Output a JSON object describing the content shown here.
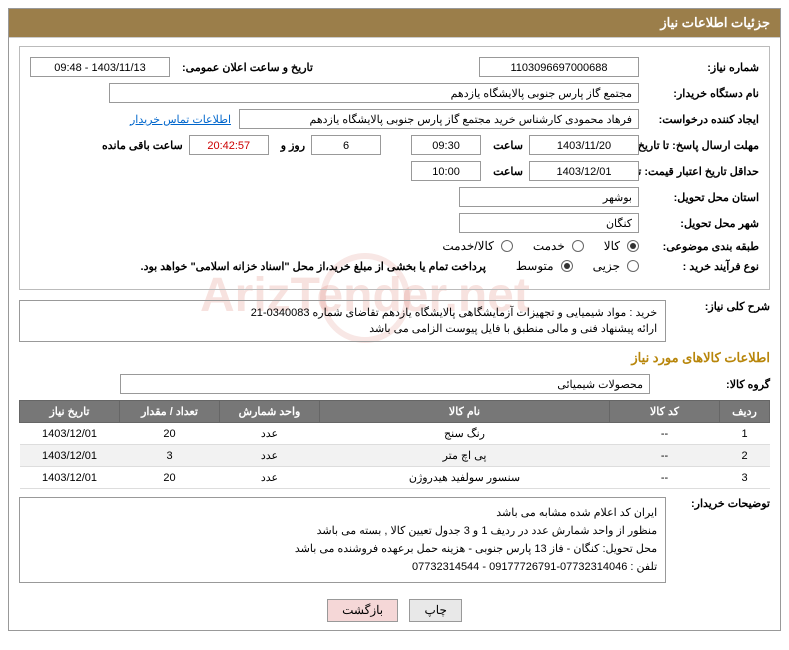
{
  "header": {
    "title": "جزئیات اطلاعات نیاز"
  },
  "fields": {
    "need_number_label": "شماره نیاز:",
    "need_number": "1103096697000688",
    "announce_label": "تاریخ و ساعت اعلان عمومی:",
    "announce_value": "1403/11/13 - 09:48",
    "buyer_org_label": "نام دستگاه خریدار:",
    "buyer_org": "مجتمع گاز پارس جنوبی  پالایشگاه یازدهم",
    "requester_label": "ایجاد کننده درخواست:",
    "requester": "فرهاد محمودی کارشناس خرید مجتمع گاز پارس جنوبی  پالایشگاه یازدهم",
    "contact_link": "اطلاعات تماس خریدار",
    "response_deadline_label": "مهلت ارسال پاسخ: تا تاریخ:",
    "response_date": "1403/11/20",
    "time_label": "ساعت",
    "response_time": "09:30",
    "days_label": "روز و",
    "days": "6",
    "remain_time": "20:42:57",
    "remain_label": "ساعت باقی مانده",
    "price_validity_label": "حداقل تاریخ اعتبار قیمت: تا تاریخ:",
    "price_date": "1403/12/01",
    "price_time": "10:00",
    "province_label": "استان محل تحویل:",
    "province": "بوشهر",
    "city_label": "شهر محل تحویل:",
    "city": "کنگان",
    "category_label": "طبقه بندی موضوعی:",
    "cat_goods": "کالا",
    "cat_service": "خدمت",
    "cat_goods_service": "کالا/خدمت",
    "process_label": "نوع فرآیند خرید :",
    "proc_partial": "جزیی",
    "proc_medium": "متوسط",
    "process_note": "پرداخت تمام یا بخشی از مبلغ خرید،از محل \"اسناد خزانه اسلامی\" خواهد بود.",
    "need_desc_label": "شرح کلی نیاز:",
    "need_desc_line1": "خرید :  مواد شیمیایی و تجهیزات آزمایشگاهی   پالایشگاه یازدهم تقاضای شماره 0340083-21",
    "need_desc_line2": "ارائه پیشنهاد فنی و مالی منطبق با فایل پیوست الزامی می باشد",
    "goods_info_title": "اطلاعات کالاهای مورد نیاز",
    "goods_group_label": "گروه کالا:",
    "goods_group": "محصولات شیمیائی",
    "buyer_notes_label": "توضیحات خریدار:",
    "buyer_notes_line1": "ایران کد اعلام شده مشابه می باشد",
    "buyer_notes_line2": "منظور از واحد شمارش عدد در ردیف 1 و 3 جدول تعیین کالا , بسته می باشد",
    "buyer_notes_line3": "محل تحویل: کنگان - فاز 13 پارس جنوبی - هزینه حمل برعهده فروشنده می باشد",
    "buyer_notes_line4": "تلفن : 07732314046-09177726791 - 07732314544"
  },
  "table": {
    "headers": {
      "row": "ردیف",
      "code": "کد کالا",
      "name": "نام کالا",
      "unit": "واحد شمارش",
      "qty": "تعداد / مقدار",
      "date": "تاریخ نیاز"
    },
    "rows": [
      {
        "idx": "1",
        "code": "--",
        "name": "رنگ سنج",
        "unit": "عدد",
        "qty": "20",
        "date": "1403/12/01"
      },
      {
        "idx": "2",
        "code": "--",
        "name": "پی اچ متر",
        "unit": "عدد",
        "qty": "3",
        "date": "1403/12/01"
      },
      {
        "idx": "3",
        "code": "--",
        "name": "سنسور سولفید هیدروژن",
        "unit": "عدد",
        "qty": "20",
        "date": "1403/12/01"
      }
    ]
  },
  "buttons": {
    "print": "چاپ",
    "back": "بازگشت"
  },
  "chart_data": {
    "type": "table",
    "title": "اطلاعات کالاهای مورد نیاز",
    "columns": [
      "ردیف",
      "کد کالا",
      "نام کالا",
      "واحد شمارش",
      "تعداد / مقدار",
      "تاریخ نیاز"
    ],
    "rows": [
      [
        "1",
        "--",
        "رنگ سنج",
        "عدد",
        "20",
        "1403/12/01"
      ],
      [
        "2",
        "--",
        "پی اچ متر",
        "عدد",
        "3",
        "1403/12/01"
      ],
      [
        "3",
        "--",
        "سنسور سولفید هیدروژن",
        "عدد",
        "20",
        "1403/12/01"
      ]
    ]
  }
}
